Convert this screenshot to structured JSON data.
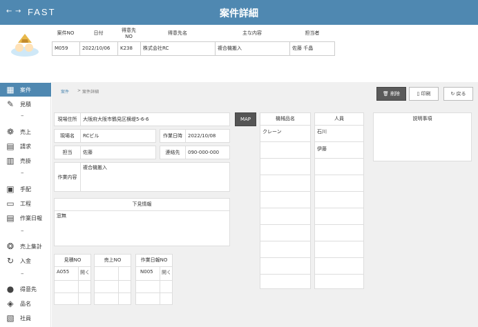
{
  "titlebar": {
    "back": "←",
    "forward": "→",
    "logo": "FAST",
    "title": "案件詳細"
  },
  "header": {
    "columns": [
      "案件NO",
      "日付",
      "得意先\nNO",
      "得意先名",
      "主な内容",
      "担当者"
    ],
    "values": [
      "M059",
      "2022/10/06",
      "K238",
      "株式会社RC",
      "複合機搬入",
      "佐藤 千晶"
    ]
  },
  "sidebar": {
    "items": [
      {
        "label": "案件",
        "icon": "calendar-icon",
        "active": true
      },
      {
        "label": "見積",
        "icon": "pencil-icon"
      },
      {
        "label": "–",
        "icon": ""
      },
      {
        "label": "売上",
        "icon": "money-bag-icon"
      },
      {
        "label": "請求",
        "icon": "invoice-icon"
      },
      {
        "label": "売掛",
        "icon": "receivable-icon"
      },
      {
        "label": "–",
        "icon": ""
      },
      {
        "label": "手配",
        "icon": "clipboard-icon"
      },
      {
        "label": "工程",
        "icon": "computer-icon"
      },
      {
        "label": "作業日報",
        "icon": "report-icon"
      },
      {
        "label": "–",
        "icon": ""
      },
      {
        "label": "売上集計",
        "icon": "coins-icon"
      },
      {
        "label": "入金",
        "icon": "refresh-icon"
      },
      {
        "label": "–",
        "icon": ""
      },
      {
        "label": "得意先",
        "icon": "person-icon"
      },
      {
        "label": "品名",
        "icon": "product-icon"
      },
      {
        "label": "社員",
        "icon": "staff-icon"
      }
    ]
  },
  "breadcrumb": {
    "root": "案件",
    "sep": ">",
    "current": "案件詳細"
  },
  "buttons": {
    "delete": "削除",
    "print": "印刷",
    "back": "戻る",
    "map": "MAP"
  },
  "site": {
    "address_label": "現場住所",
    "address": "大阪府大阪市鶴見区横堤5-6-6",
    "name_label": "現場名",
    "name": "RCビル",
    "workdate_label": "作業日時",
    "workdate": "2022/10/08",
    "staff_label": "担当",
    "staff": "佐藤",
    "contact_label": "連絡先",
    "contact": "090-000-000",
    "content_label": "作業内容",
    "content": "複合機搬入",
    "survey_label": "下見情報",
    "survey": "窓無"
  },
  "machines": {
    "header": "機械品名",
    "rows": [
      "クレーン",
      "",
      "",
      "",
      "",
      "",
      "",
      "",
      "",
      ""
    ]
  },
  "people": {
    "header": "人員",
    "rows": [
      "石川",
      "伊藤",
      "",
      "",
      "",
      "",
      "",
      "",
      "",
      ""
    ]
  },
  "notes": {
    "header": "説明事項",
    "value": ""
  },
  "refs": {
    "estimate": {
      "header": "見積NO",
      "value": "A055",
      "open": "開く"
    },
    "sales": {
      "header": "売上NO",
      "value": "",
      "open": ""
    },
    "report": {
      "header": "作業日報NO",
      "value": "N005",
      "open": "開く"
    }
  }
}
